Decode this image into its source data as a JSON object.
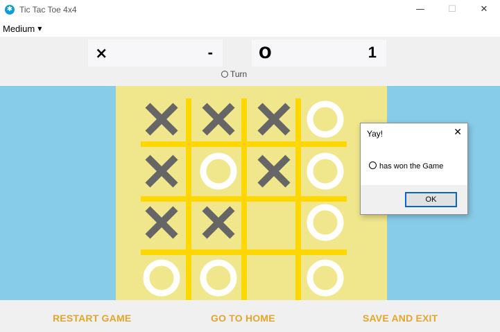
{
  "window": {
    "title": "Tic Tac Toe 4x4",
    "app_icon": "gear-icon",
    "minimize_glyph": "—",
    "maximize_glyph": "☐",
    "close_glyph": "✕"
  },
  "menu": {
    "difficulty": "Medium",
    "caret": "▼"
  },
  "scores": {
    "x": {
      "symbol": "×",
      "value": "-"
    },
    "o": {
      "symbol": "O",
      "value": "1"
    }
  },
  "turn": {
    "label": "Turn"
  },
  "board": {
    "size": 4,
    "cells": [
      [
        "X",
        "X",
        "X",
        "O"
      ],
      [
        "X",
        "O",
        "X",
        "O"
      ],
      [
        "X",
        "X",
        "",
        "O"
      ],
      [
        "O",
        "O",
        "",
        "O"
      ]
    ],
    "colors": {
      "background": "#f0e68c",
      "lines": "#ffd700",
      "x": "#666666",
      "o": "#ffffff",
      "side": "#87cdea"
    }
  },
  "dialog": {
    "title": "Yay!",
    "close_glyph": "✕",
    "message": "has won the Game",
    "ok_label": "OK"
  },
  "actions": {
    "restart": "RESTART GAME",
    "home": "GO TO HOME",
    "save": "SAVE AND EXIT"
  }
}
